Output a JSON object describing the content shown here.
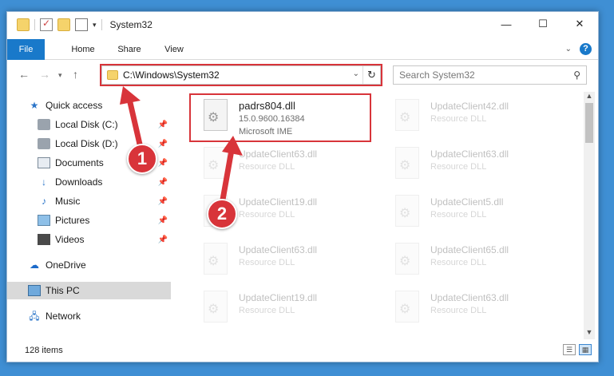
{
  "window": {
    "title": "System32",
    "buttons": {
      "minimize": "—",
      "maximize": "☐",
      "close": "✕"
    }
  },
  "ribbon": {
    "tabs": [
      "File",
      "Home",
      "Share",
      "View"
    ],
    "help": "?"
  },
  "nav": {
    "address": "C:\\Windows\\System32",
    "search_placeholder": "Search System32"
  },
  "sidebar": {
    "items": [
      {
        "label": "Quick access",
        "icon": "star-icon",
        "pinned": false
      },
      {
        "label": "Local Disk (C:)",
        "icon": "drive-icon",
        "pinned": true
      },
      {
        "label": "Local Disk (D:)",
        "icon": "drive-icon",
        "pinned": true
      },
      {
        "label": "Documents",
        "icon": "documents-icon",
        "pinned": true
      },
      {
        "label": "Downloads",
        "icon": "download-icon",
        "pinned": true
      },
      {
        "label": "Music",
        "icon": "music-icon",
        "pinned": true
      },
      {
        "label": "Pictures",
        "icon": "pictures-icon",
        "pinned": true
      },
      {
        "label": "Videos",
        "icon": "video-icon",
        "pinned": true
      },
      {
        "label": "OneDrive",
        "icon": "cloud-icon",
        "pinned": false
      },
      {
        "label": "This PC",
        "icon": "computer-icon",
        "pinned": false
      },
      {
        "label": "Network",
        "icon": "network-icon",
        "pinned": false
      }
    ]
  },
  "files": [
    {
      "name": "padrs804.dll",
      "line2": "15.0.9600.16384",
      "line3": "Microsoft IME"
    },
    {
      "name": "UpdateClient42.dll",
      "line2": "Resource DLL"
    },
    {
      "name": "UpdateClient63.dll",
      "line2": "Resource DLL"
    },
    {
      "name": "UpdateClient63.dll",
      "line2": "Resource DLL"
    },
    {
      "name": "UpdateClient19.dll",
      "line2": "Resource DLL"
    },
    {
      "name": "UpdateClient5.dll",
      "line2": "Resource DLL"
    },
    {
      "name": "UpdateClient63.dll",
      "line2": "Resource DLL"
    },
    {
      "name": "UpdateClient65.dll",
      "line2": "Resource DLL"
    },
    {
      "name": "UpdateClient19.dll",
      "line2": "Resource DLL"
    },
    {
      "name": "UpdateClient63.dll",
      "line2": "Resource DLL"
    }
  ],
  "status": {
    "count": "128 items"
  },
  "annotations": {
    "step1": "1",
    "step2": "2"
  },
  "colors": {
    "accent": "#1979ca",
    "highlight": "#d8343a",
    "desktop": "#3f8fd4"
  }
}
